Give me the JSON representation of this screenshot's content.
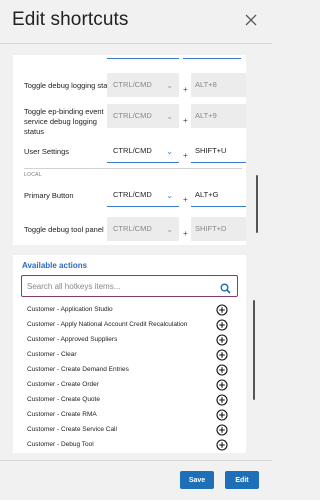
{
  "dialog": {
    "title": "Edit shortcuts"
  },
  "shortcuts": {
    "rows": [
      {
        "label": "Toggle debug logging status",
        "modifier": "CTRL/CMD",
        "plus": "+",
        "key": "ALT+8",
        "enabled": false
      },
      {
        "label": "Toggle ep-binding event service debug logging status",
        "modifier": "CTRL/CMD",
        "plus": "+",
        "key": "ALT+9",
        "enabled": false
      },
      {
        "label": "User Settings",
        "modifier": "CTRL/CMD",
        "plus": "+",
        "key": "SHIFT+U",
        "enabled": true
      },
      {
        "label": "Primary Button",
        "modifier": "CTRL/CMD",
        "plus": "+",
        "key": "ALT+G",
        "enabled": true
      },
      {
        "label": "Toggle debug tool panel",
        "modifier": "CTRL/CMD",
        "plus": "+",
        "key": "SHIFT+D",
        "enabled": false
      }
    ],
    "section_label": "LOCAL"
  },
  "actions": {
    "title": "Available actions",
    "search_placeholder": "Search all hotkeys items...",
    "items": [
      "Customer - Application Studio",
      "Customer - Apply National Account Credit Recalculation",
      "Customer - Approved Suppliers",
      "Customer - Clear",
      "Customer - Create Demand Entries",
      "Customer - Create Order",
      "Customer - Create Quote",
      "Customer - Create RMA",
      "Customer - Create Service Call",
      "Customer - Debug Tool"
    ]
  },
  "footer": {
    "save_label": "Save",
    "edit_label": "Edit"
  },
  "colors": {
    "accent": "#3b7bd4",
    "primary_button": "#1f6fb8",
    "search_border": "#8a3a6a",
    "section_title": "#2a6ac2"
  }
}
